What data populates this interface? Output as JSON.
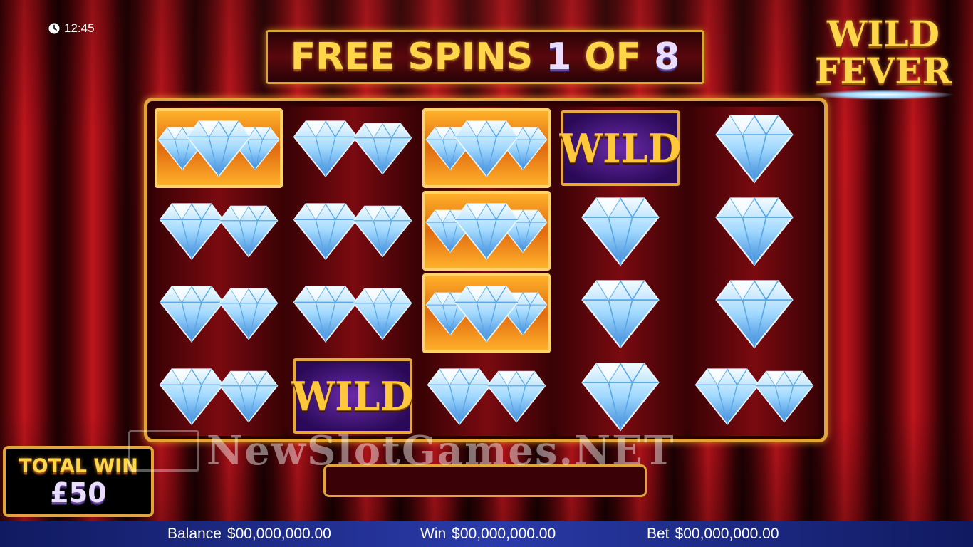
{
  "clock": {
    "time": "12:45",
    "icon": "clock-icon"
  },
  "header": {
    "free_spins_label": "FREE SPINS",
    "current": "1",
    "of_label": "OF",
    "total": "8"
  },
  "logo": {
    "line1": "WILD",
    "line2": "FEVER"
  },
  "reels": [
    [
      "diamond-triple-gold",
      "diamond-double",
      "diamond-double",
      "diamond-double"
    ],
    [
      "diamond-double",
      "diamond-double",
      "diamond-double",
      "wild"
    ],
    [
      "diamond-triple-gold",
      "diamond-triple-gold",
      "diamond-triple-gold",
      "diamond-double"
    ],
    [
      "wild",
      "diamond",
      "diamond",
      "diamond"
    ],
    [
      "diamond",
      "diamond",
      "diamond",
      "diamond-double"
    ]
  ],
  "wild_label": "WILD",
  "total_win": {
    "label": "TOTAL WIN",
    "amount": "£50"
  },
  "watermark": "NewSlotGames.NET",
  "status_bar": {
    "balance_label": "Balance",
    "balance_value": "$00,000,000.00",
    "win_label": "Win",
    "win_value": "$00,000,000.00",
    "bet_label": "Bet",
    "bet_value": "$00,000,000.00"
  },
  "colors": {
    "gold": "#ffd54a",
    "frame": "#e2a43a",
    "curtain": "#c0151c",
    "status_bar": "#2a3aa8"
  }
}
